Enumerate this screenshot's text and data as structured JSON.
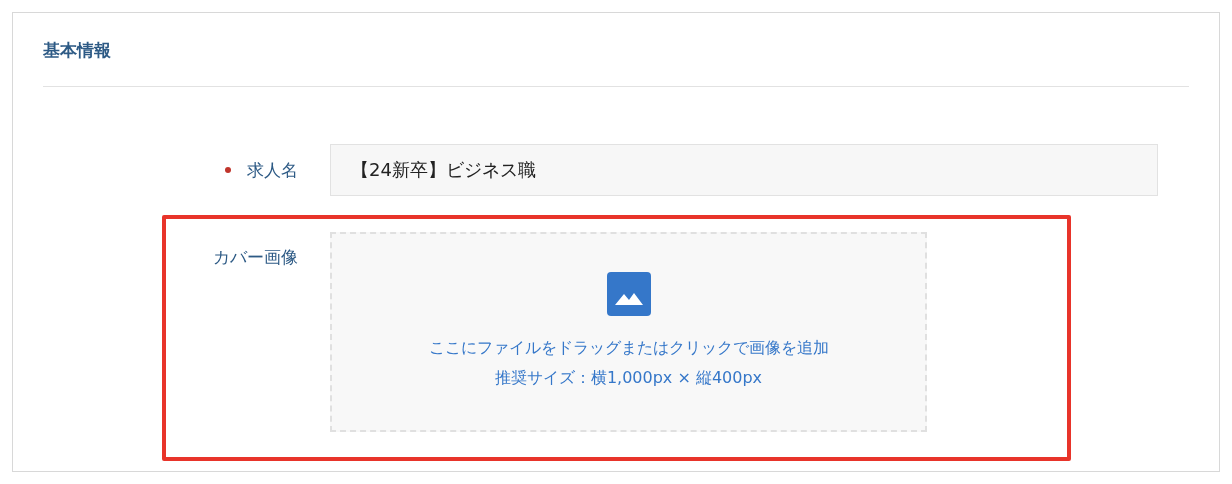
{
  "section": {
    "title": "基本情報"
  },
  "fields": [
    {
      "kind": "text",
      "label": "求人名",
      "required": true,
      "value": "【24新卒】ビジネス職",
      "highlighted": false
    },
    {
      "kind": "image-upload",
      "label": "カバー画像",
      "required": false,
      "highlighted": true,
      "instructions": [
        "ここにファイルをドラッグまたはクリックで画像を追加",
        "推奨サイズ：横1,000px × 縦400px"
      ]
    }
  ]
}
